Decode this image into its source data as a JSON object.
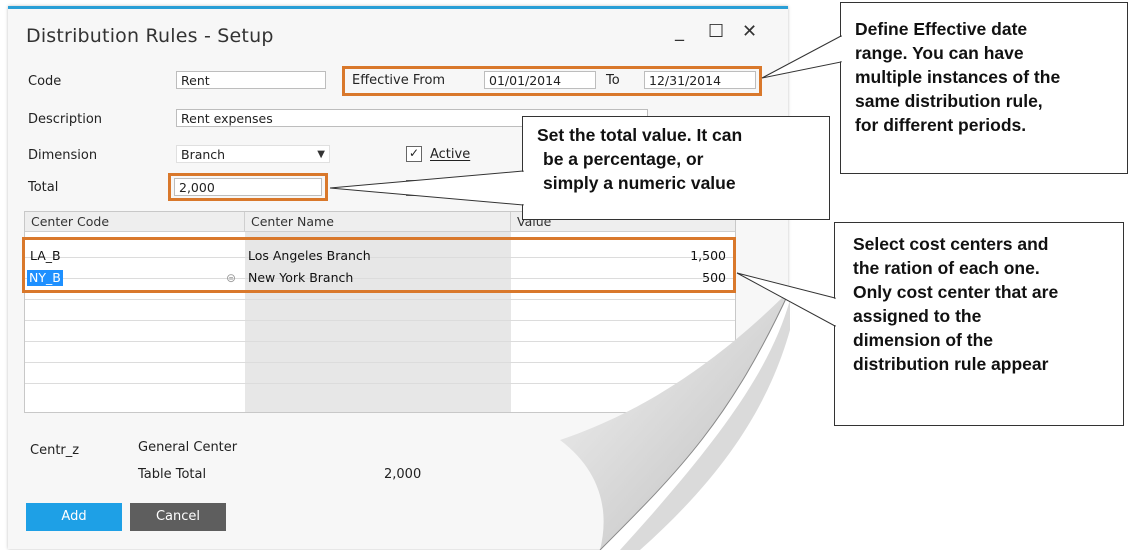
{
  "window": {
    "title": "Distribution Rules - Setup",
    "controls": {
      "minimize": "_",
      "maximize": "☐",
      "close": "✕"
    }
  },
  "form": {
    "code_label": "Code",
    "code_value": "Rent",
    "effective_from_label": "Effective From",
    "effective_from_value": "01/01/2014",
    "to_label": "To",
    "to_value": "12/31/2014",
    "description_label": "Description",
    "description_value": "Rent expenses",
    "dimension_label": "Dimension",
    "dimension_value": "Branch",
    "active_label": "Active",
    "active_checked": true,
    "total_label": "Total",
    "total_value": "2,000"
  },
  "grid": {
    "headers": [
      "Center Code",
      "Center Name",
      "Value"
    ],
    "rows": [
      {
        "code": "LA_B",
        "name": "Los Angeles Branch",
        "value": "1,500"
      },
      {
        "code": "NY_B",
        "name": "New York Branch",
        "value": "500"
      }
    ]
  },
  "footer": {
    "centr_label": "Centr_z",
    "general_center": "General Center",
    "table_total_label": "Table Total",
    "table_total_value": "2,000"
  },
  "buttons": {
    "add": "Add",
    "cancel": "Cancel"
  },
  "colors": {
    "accent": "#2a9fd6",
    "highlight": "#d9782b",
    "add_button": "#1ea0e6",
    "cancel_button": "#5e5e5e"
  },
  "callouts": {
    "date_range": {
      "line1": "Define Effective date",
      "line2": "range. You can have",
      "line3": "multiple instances of the",
      "line4": "same distribution rule,",
      "line5": "for different periods."
    },
    "total": {
      "line1": "Set the total value. It can",
      "line2": "be a percentage, or",
      "line3": "simply a numeric value"
    },
    "centers": {
      "line1": "Select cost centers and",
      "line2": "the ration of each one.",
      "line3": "Only cost center that are",
      "line4": "assigned to the",
      "line5": "dimension of the",
      "line6": "distribution rule appear"
    }
  }
}
